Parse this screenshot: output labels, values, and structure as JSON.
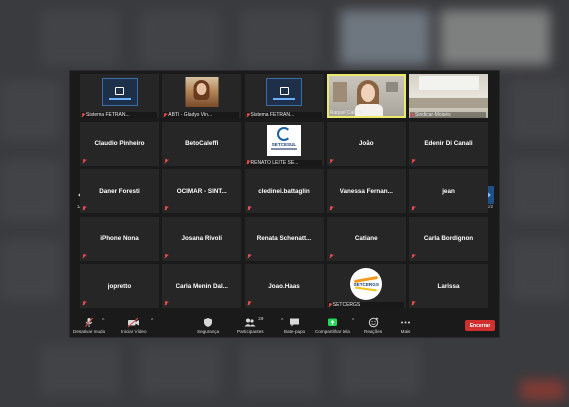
{
  "colors": {
    "window_bg": "#1a1a1a",
    "tile_bg": "#262626",
    "active_speaker_border": "#e9e96a",
    "muted_mic": "#e34b4b",
    "share_green": "#23d959",
    "end_button": "#d2302f",
    "pager_active": "#1e4f86"
  },
  "meeting": {
    "reaction_icon": "raised-hand-icon",
    "pager": {
      "left_indicator": "1/2",
      "right_indicator": "1/2"
    }
  },
  "tiles": [
    {
      "caption": "Sistema FETRAN...",
      "kind": "logo"
    },
    {
      "caption": "ABTI - Gladys Vin...",
      "kind": "portrait"
    },
    {
      "caption": "Sistema FETRAN...",
      "kind": "logo"
    },
    {
      "caption": "Raquel Caleffi",
      "kind": "video-woman",
      "active": true
    },
    {
      "caption": "Sindicar-Moisés",
      "kind": "video-room"
    },
    {
      "name": "Claudio Pinheiro"
    },
    {
      "name": "BetoCaleffi"
    },
    {
      "caption": "RENATO LEITE SE...",
      "kind": "setcesul",
      "logo_text": "SETCESUL"
    },
    {
      "name": "João"
    },
    {
      "name": "Edenir Di Canali"
    },
    {
      "name": "Daner Foresti"
    },
    {
      "name": "OCIMAR - SINT..."
    },
    {
      "name": "cledinei.battaglin"
    },
    {
      "name": "Vanessa  Fernan..."
    },
    {
      "name": "jean"
    },
    {
      "name": "iPhone Nona"
    },
    {
      "name": "Josana Rivoli"
    },
    {
      "name": "Renata  Schenatt..."
    },
    {
      "name": "Catiane"
    },
    {
      "name": "Carla Bordignon"
    },
    {
      "name": "jopretto"
    },
    {
      "name": "Carla  Menin  Dal..."
    },
    {
      "name": "Joao.Haas"
    },
    {
      "caption": "SETCERGS",
      "kind": "setcergs",
      "logo_text": "SETCERGS"
    },
    {
      "name": "Larissa"
    }
  ],
  "toolbar": {
    "mute_label": "Desativar mudo",
    "video_label": "Iniciar Vídeo",
    "security_label": "Segurança",
    "participants_label": "Participantes",
    "participants_count": "29",
    "chat_label": "Bate-papo",
    "share_label": "Compartilhar tela",
    "reactions_label": "Reações",
    "more_label": "Mais",
    "end_label": "Encerrar",
    "caret": "^"
  }
}
